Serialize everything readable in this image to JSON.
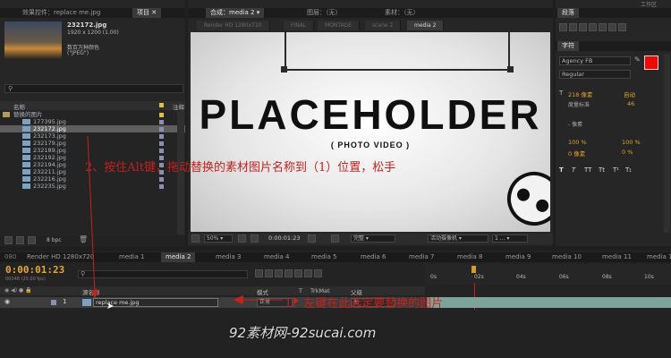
{
  "project_panel": {
    "tab_effects_prefix": "效果控件：",
    "tab_effects_file": "replace me.jpg",
    "tab_project": "项目",
    "preview": {
      "filename": "232172.jpg",
      "size": "1920 x 1200 (1.00)",
      "colors": "数百万种颜色",
      "type": "(\"JPEG\")"
    },
    "search_placeholder": "",
    "col_name": "名称",
    "col_label": "注释",
    "folder": "替换的图片",
    "files": [
      "177395.jpg",
      "232172.jpg",
      "232173.jpg",
      "232179.jpg",
      "232189.jpg",
      "232192.jpg",
      "232194.jpg",
      "232211.jpg",
      "232216.jpg",
      "232235.jpg"
    ],
    "selected_file": "232172.jpg",
    "bpc": "8 bpc"
  },
  "comp_panel": {
    "tab_comp_prefix": "合成：",
    "tab_comp_name": "media 2",
    "tab_layer": "图层：（无）",
    "tab_footage": "素材：（无）",
    "sub_tabs": [
      "Render HD 1280x720",
      "FINAL",
      "MONTAGE",
      "scene 2",
      "media 2"
    ],
    "active_sub_tab": "media 2",
    "placeholder_title": "PLACEHOLDER",
    "placeholder_sub": "( PHOTO VIDEO )",
    "zoom": "50%",
    "timecode": "0:00:01:23",
    "quality": "完整",
    "camera": "活动摄像机",
    "views": "1 ..."
  },
  "right_panel": {
    "tab_paragraph": "段落",
    "tab_character": "字符",
    "font": "Agency FB",
    "style": "Regular",
    "size_val": "218 像素",
    "auto_label": "自动",
    "tracking_label": "度量标准",
    "tracking_val": "46",
    "px_label": "- 像素",
    "pct1": "100 %",
    "pct2": "100 %",
    "px0": "0 像素",
    "pct0": "0 %",
    "tt_buttons": [
      "T",
      "T",
      "TT",
      "Tt",
      "T¹",
      "T₁"
    ],
    "top_tab": "工作区"
  },
  "timeline": {
    "tabs": [
      "Render HD 1280x720",
      "media 1",
      "media 2",
      "media 3",
      "media 4",
      "media 5",
      "media 6",
      "media 7",
      "media 8",
      "media 9",
      "media 10",
      "media 11",
      "media 12"
    ],
    "active_tab": "media 2",
    "left_num": "080",
    "timecode": "0:00:01:23",
    "fps": "00048 (25.00 fps)",
    "col_source": "源名称",
    "col_mode": "模式",
    "col_t": "T",
    "col_trkmat": "TrkMat",
    "col_parent": "父级",
    "layer_num": "1",
    "layer_name": "replace me.jpg",
    "layer_mode": "正常",
    "layer_parent": "无",
    "ruler": [
      "0s",
      "02s",
      "04s",
      "06s",
      "08s",
      "10s"
    ]
  },
  "annotations": {
    "step2": "2、按住Alt键，拖动替换的素材图片名称到（1）位置，松手",
    "step1": "1、左键在此选定要替换的图片",
    "watermark": "92素材网-92sucai.com"
  },
  "colors": {
    "accent_red": "#c7211e",
    "color_swatch": "#ff0000",
    "timeline_green": "#7fa39a",
    "cti_orange": "#d8a020"
  }
}
